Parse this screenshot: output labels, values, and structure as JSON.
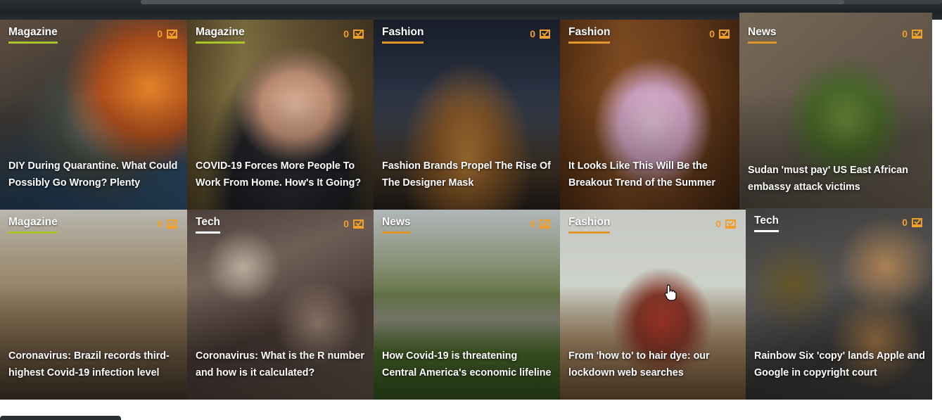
{
  "cards": [
    {
      "category": "Magazine",
      "comments": "0",
      "title": "DIY During Quarantine. What Could Possibly Go Wrong? Plenty"
    },
    {
      "category": "Magazine",
      "comments": "0",
      "title": "COVID-19 Forces More People To Work From Home. How's It Going?"
    },
    {
      "category": "Fashion",
      "comments": "0",
      "title": "Fashion Brands Propel The Rise Of The Designer Mask"
    },
    {
      "category": "Fashion",
      "comments": "0",
      "title": "It Looks Like This Will Be the Breakout Trend of the Summer"
    },
    {
      "category": "News",
      "comments": "0",
      "title": "Sudan 'must pay' US East African embassy attack victims"
    },
    {
      "category": "Magazine",
      "comments": "0",
      "title": "Coronavirus: Brazil records third-highest Covid-19 infection level"
    },
    {
      "category": "Tech",
      "comments": "0",
      "title": "Coronavirus: What is the R number and how is it calculated?"
    },
    {
      "category": "News",
      "comments": "0",
      "title": "How Covid-19 is threatening Central America's economic lifeline"
    },
    {
      "category": "Fashion",
      "comments": "0",
      "title": "From 'how to' to hair dye: our lockdown web searches"
    },
    {
      "category": "Tech",
      "comments": "0",
      "title": "Rainbow Six 'copy' lands Apple and Google in copyright court"
    }
  ],
  "icons": {
    "comment": "comment-box-icon",
    "cursor": "hand-pointer-icon"
  },
  "colors": {
    "accent_orange": "#e0962b",
    "accent_green": "#a7c42a",
    "comment_color": "#f0a028"
  }
}
